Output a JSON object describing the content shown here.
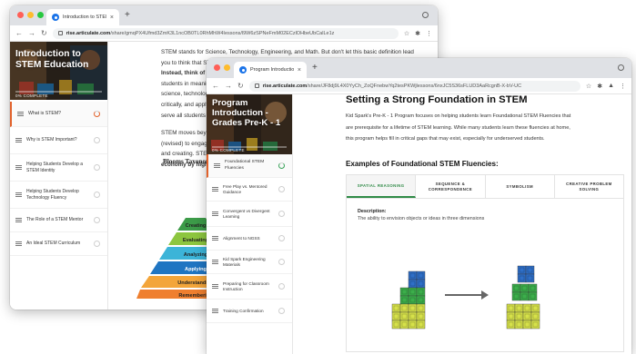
{
  "colors": {
    "traffic_red": "#ff5f57",
    "traffic_yellow": "#febc2e",
    "traffic_green": "#28c840",
    "accent_orange": "#e2622b",
    "accent_green": "#2f8a46"
  },
  "window1": {
    "tab_title": "Introduction to STEM Educatio",
    "url_host": "rise.articulate.com",
    "url_path": "/share/gmqPX4Ufmd3ZmK3L1ncOB0TL0RhMhW4Iessons/l9W6zSPNeFmM02ECzlOHbeUbCalLe1z",
    "sidebar": {
      "course_title": "Introduction to STEM Education",
      "complete_text": "0% COMPLETE",
      "lessons": [
        {
          "label": "What is STEM?"
        },
        {
          "label": "Why is STEM Important?"
        },
        {
          "label": "Helping Students Develop a STEM Identity"
        },
        {
          "label": "Helping Students Develop Technology Fluency"
        },
        {
          "label": "The Role of a STEM Mentor"
        },
        {
          "label": "An Ideal STEM Curriculum"
        }
      ]
    },
    "main": {
      "lines": [
        "STEM stands for Science, Technology, Engineering, and Math. But don't let this basic definition lead",
        "you to think that STEM is about teaching these subjects separately and in isolation from one another.",
        "Instead, think of STEM a",
        "students in meaningful a",
        "science, technology, eng",
        "critically, and apply prac",
        "serve all students well in"
      ],
      "lines2": [
        "STEM moves beyond the",
        "(revised) to engage stud",
        "and creating. STEM also",
        "economy by highlighting"
      ],
      "bloom_title": "Blooms Taxonomy -",
      "pyramid": [
        "Creating",
        "Evaluating",
        "Analyzing",
        "Applying",
        "Understanding",
        "Remembering"
      ]
    }
  },
  "window2": {
    "tab_title": "Program Introduction - Grades",
    "url_host": "rise.articulate.com",
    "url_path": "/share/JF8dj9L4X0YyCh_ZoQFnebwYq2tesPKWjlessons/6nxJC5S36sFLUD3AaRcgnB-X-bV-UC",
    "sidebar": {
      "course_title": "Program Introduction - Grades Pre-K - 1",
      "complete_text": "0% COMPLETE",
      "lessons": [
        {
          "label": "Foundational STEM Fluencies"
        },
        {
          "label": "Free Play vs. Mentored Guidance"
        },
        {
          "label": "Convergent vs Divergent Learning"
        },
        {
          "label": "Alignment to NGSS"
        },
        {
          "label": "Kid Spark Engineering Materials"
        },
        {
          "label": "Preparing for Classroom Instruction"
        },
        {
          "label": "Training Confirmation"
        }
      ]
    },
    "main": {
      "heading": "Setting a Strong Foundation in STEM",
      "intro_lines": [
        "Kid Spark's Pre-K - 1 Program focuses on helping students learn Foundational STEM Fluencies that",
        "are prerequisite for a lifetime of STEM learning. While many students learn these fluencies at home,",
        "this program helps fill in critical gaps that may exist, especially for underserved students."
      ],
      "subheading": "Examples of Foundational STEM Fluencies:",
      "tabs": [
        "SPATIAL REASONING",
        "SEQUENCE & CORRESPONDENCE",
        "SYMBOLISM",
        "CREATIVE PROBLEM SOLVING"
      ],
      "description_label": "Description:",
      "description_text": "The ability to envision objects or ideas in three dimensions"
    }
  }
}
